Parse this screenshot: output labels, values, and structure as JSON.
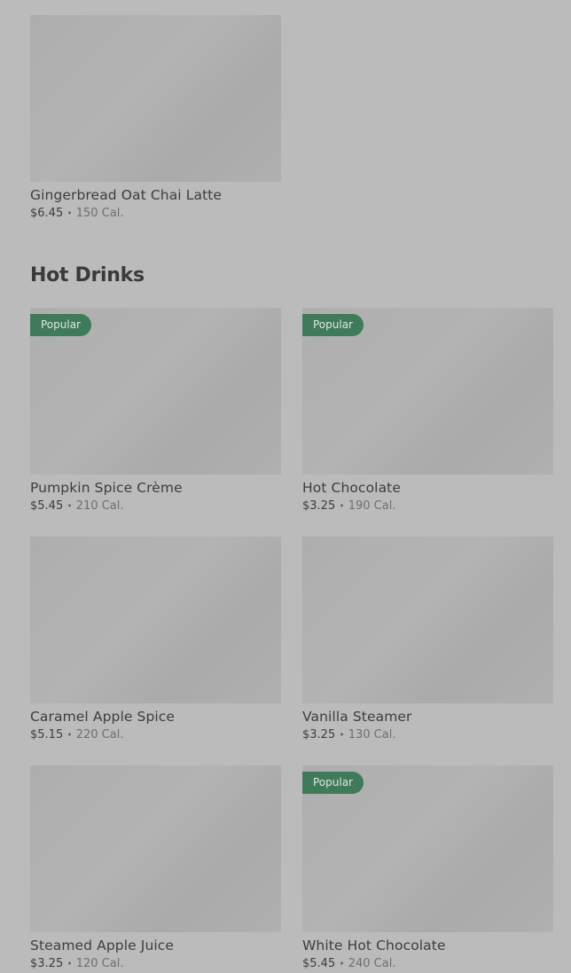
{
  "top_items": [
    {
      "name": "Gingerbread Oat Chai Latte",
      "price": "$6.45",
      "calories": "150 Cal.",
      "badge": ""
    }
  ],
  "section": {
    "title": "Hot Drinks",
    "items": [
      {
        "name": "Pumpkin Spice Crème",
        "price": "$5.45",
        "calories": "210 Cal.",
        "badge": "Popular"
      },
      {
        "name": "Hot Chocolate",
        "price": "$3.25",
        "calories": "190 Cal.",
        "badge": "Popular"
      },
      {
        "name": "Caramel Apple Spice",
        "price": "$5.15",
        "calories": "220 Cal.",
        "badge": ""
      },
      {
        "name": "Vanilla Steamer",
        "price": "$3.25",
        "calories": "130 Cal.",
        "badge": ""
      },
      {
        "name": "Steamed Apple Juice",
        "price": "$3.25",
        "calories": "120 Cal.",
        "badge": ""
      },
      {
        "name": "White Hot Chocolate",
        "price": "$5.45",
        "calories": "240 Cal.",
        "badge": "Popular"
      }
    ]
  },
  "separator": "•",
  "colors": {
    "badge_bg": "#3f7a5a",
    "overlay_bg": "#bbbbbb"
  }
}
